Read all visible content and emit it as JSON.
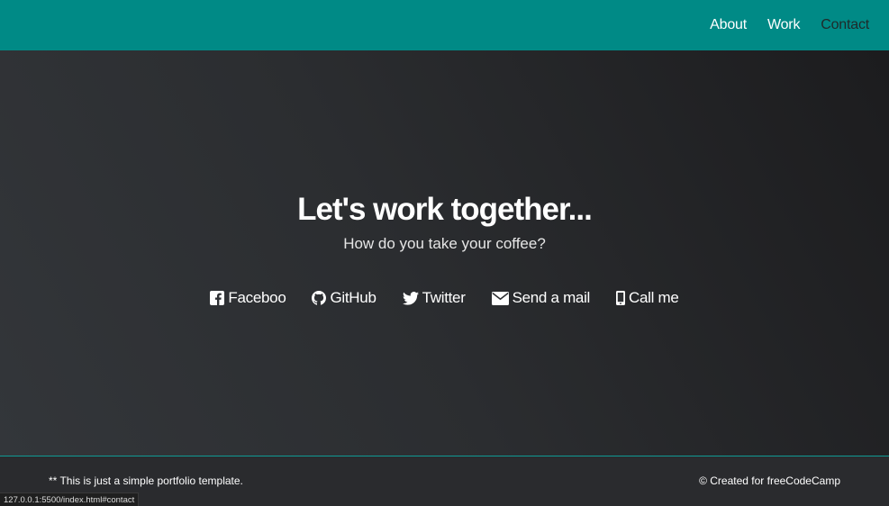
{
  "nav": {
    "items": [
      {
        "label": "About"
      },
      {
        "label": "Work"
      },
      {
        "label": "Contact"
      }
    ]
  },
  "contact": {
    "heading": "Let's work together...",
    "subheading": "How do you take your coffee?",
    "links": [
      {
        "label": "Faceboo",
        "icon": "facebook-icon"
      },
      {
        "label": "GitHub",
        "icon": "github-icon"
      },
      {
        "label": "Twitter",
        "icon": "twitter-icon"
      },
      {
        "label": "Send a mail",
        "icon": "envelope-icon"
      },
      {
        "label": "Call me",
        "icon": "mobile-phone-icon"
      }
    ]
  },
  "footer": {
    "left_text": "** This is just a simple portfolio template.",
    "right_text": "© Created for freeCodeCamp"
  },
  "status_bar": {
    "url": "127.0.0.1:5500/index.html#contact"
  },
  "colors": {
    "navbar": "#008a86",
    "background": "#2a2b2e",
    "footer_border": "#0f9a94",
    "text": "#ffffff"
  }
}
